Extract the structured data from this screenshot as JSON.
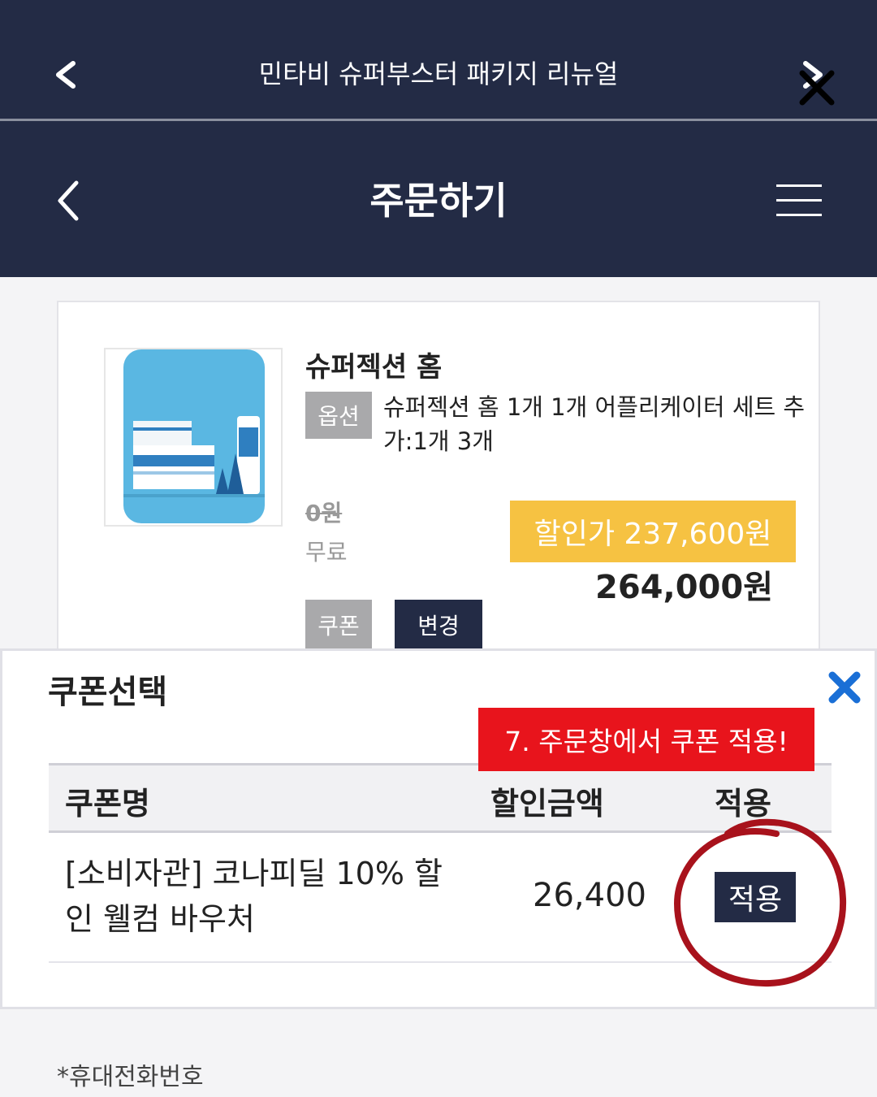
{
  "browser_bar": {
    "title": "민타비 슈퍼부스터 패키지 리뉴얼",
    "back_icon": "chevron-left-icon",
    "next_icon": "chevron-right-icon",
    "close_icon": "close-icon"
  },
  "header": {
    "title": "주문하기",
    "back_icon": "chevron-left-icon",
    "menu_icon": "hamburger-menu-icon"
  },
  "product": {
    "name": "슈퍼젝션 홈",
    "option_tag": "옵션",
    "option_text": "슈퍼젝션 홈 1개 1개 어플리케이터 세트 추가:1개 3개",
    "shipping_original": "0원",
    "shipping_label": "무료",
    "sale_price_label": "할인가 237,600원",
    "price": "264,000원",
    "coupon_tag": "쿠폰",
    "change_button": "변경",
    "image_icon": "product-image"
  },
  "coupon_modal": {
    "title": "쿠폰선택",
    "annotation": "7. 주문창에서 쿠폰 적용!",
    "columns": {
      "name": "쿠폰명",
      "amount": "할인금액",
      "apply": "적용"
    },
    "rows": [
      {
        "name": "[소비자관] 코나피딜 10% 할인 웰컴 바우처",
        "amount": "26,400",
        "apply_button": "적용"
      }
    ],
    "close_icon": "close-x-icon"
  },
  "form": {
    "phone_label": "*휴대전화번호"
  },
  "colors": {
    "navy": "#232b45",
    "sale_yellow": "#f6c242",
    "annotation_red": "#e8141c",
    "close_blue": "#1a6fd6",
    "circle_red": "#a8121c"
  }
}
